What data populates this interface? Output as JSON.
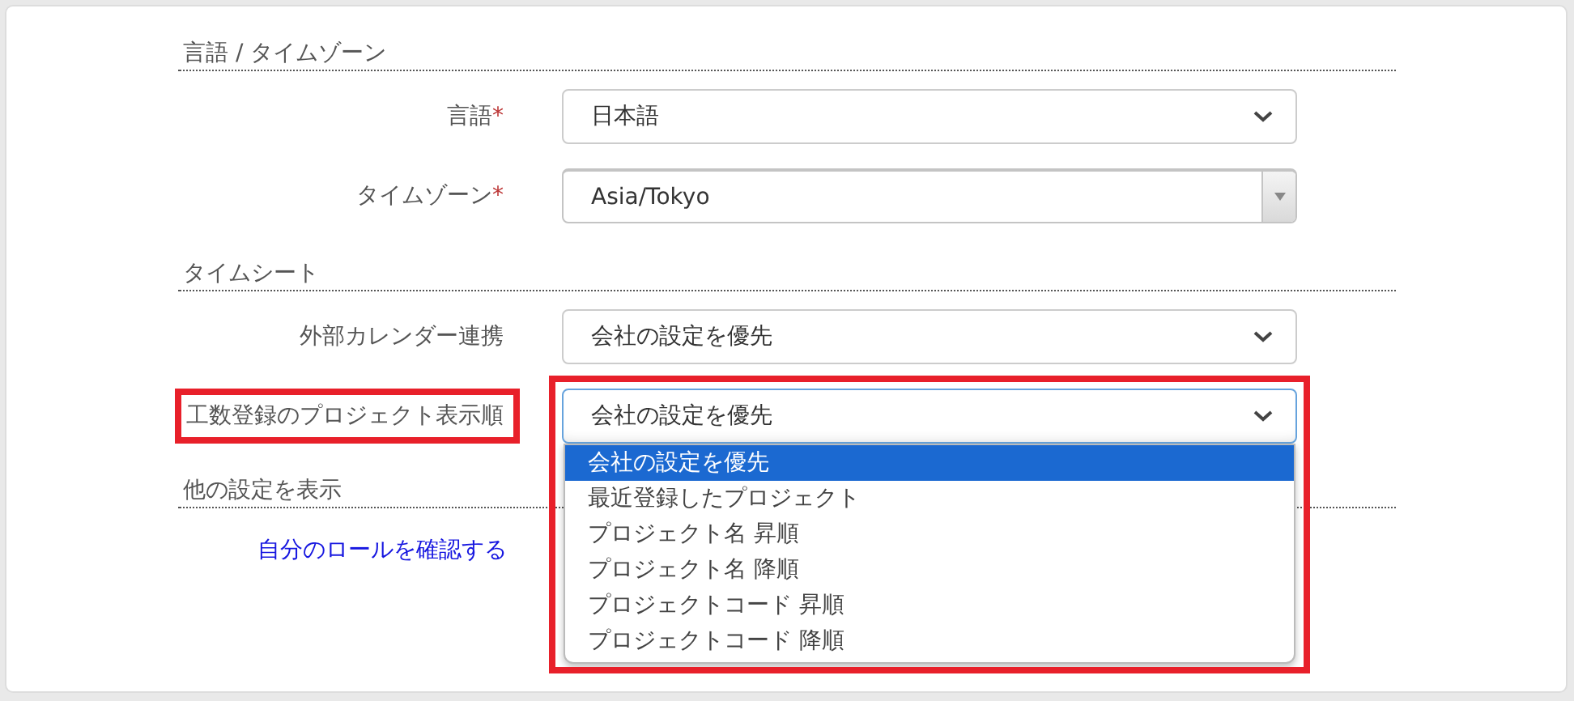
{
  "sections": [
    {
      "title": "言語 / タイムゾーン",
      "rows": [
        {
          "label": "言語",
          "required_mark": "*",
          "field": {
            "kind": "select",
            "value": "日本語"
          }
        },
        {
          "label": "タイムゾーン",
          "required_mark": "*",
          "field": {
            "kind": "combo",
            "value": "Asia/Tokyo"
          }
        }
      ]
    },
    {
      "title": "タイムシート",
      "rows": [
        {
          "label": "外部カレンダー連携",
          "field": {
            "kind": "select",
            "value": "会社の設定を優先"
          }
        },
        {
          "label": "工数登録のプロジェクト表示順",
          "highlighted": true,
          "field": {
            "kind": "select",
            "value": "会社の設定を優先",
            "focused": true,
            "expanded": true,
            "highlighted": true,
            "options": [
              {
                "label": "会社の設定を優先",
                "selected": true
              },
              {
                "label": "最近登録したプロジェクト",
                "selected": false
              },
              {
                "label": "プロジェクト名 昇順",
                "selected": false
              },
              {
                "label": "プロジェクト名 降順",
                "selected": false
              },
              {
                "label": "プロジェクトコード 昇順",
                "selected": false
              },
              {
                "label": "プロジェクトコード 降順",
                "selected": false
              }
            ]
          }
        }
      ]
    },
    {
      "title": "他の設定を表示",
      "links": [
        "自分のロールを確認する"
      ]
    }
  ]
}
